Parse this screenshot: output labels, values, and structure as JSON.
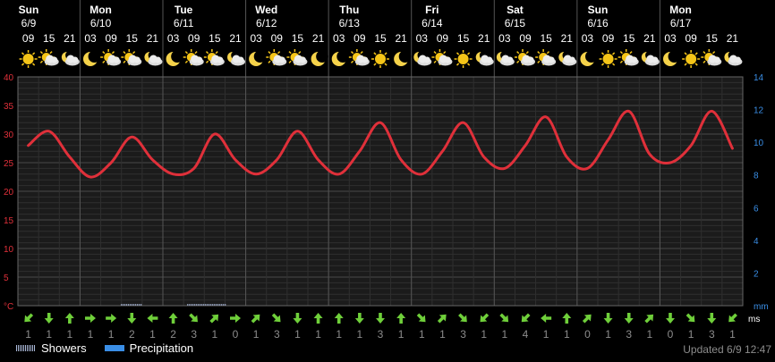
{
  "days": [
    {
      "name": "Sun",
      "date": "6/9"
    },
    {
      "name": "Mon",
      "date": "6/10"
    },
    {
      "name": "Tue",
      "date": "6/11"
    },
    {
      "name": "Wed",
      "date": "6/12"
    },
    {
      "name": "Thu",
      "date": "6/13"
    },
    {
      "name": "Fri",
      "date": "6/14"
    },
    {
      "name": "Sat",
      "date": "6/15"
    },
    {
      "name": "Sun",
      "date": "6/16"
    },
    {
      "name": "Mon",
      "date": "6/17"
    }
  ],
  "legend": {
    "showers": "Showers",
    "precipitation": "Precipitation"
  },
  "updated": "Updated 6/9 12:47",
  "colors": {
    "temperature": "#e0303a",
    "left_axis": "#e0303a",
    "right_axis": "#3a8ee6",
    "wind_arrow": "#6fcf3a",
    "precipitation": "#3a8ee6"
  },
  "chart_data": {
    "type": "line",
    "x": [
      "09",
      "15",
      "21",
      "03",
      "09",
      "15",
      "21",
      "03",
      "09",
      "15",
      "21",
      "03",
      "09",
      "15",
      "21",
      "03",
      "09",
      "15",
      "21",
      "03",
      "09",
      "15",
      "21",
      "03",
      "09",
      "15",
      "21",
      "03",
      "09",
      "15",
      "21",
      "03",
      "09",
      "15",
      "21"
    ],
    "series": [
      {
        "values": [
          28,
          30.5,
          26,
          22.5,
          25,
          29.5,
          25.5,
          23,
          24,
          30,
          25.5,
          23,
          25.5,
          30.5,
          25.5,
          23,
          27,
          32,
          25.5,
          23,
          27,
          32,
          26,
          24,
          28,
          33,
          26,
          24,
          29,
          34,
          26.5,
          25,
          28,
          34,
          27.5
        ]
      }
    ],
    "wind_icons": [
      "arrow-sw",
      "arrow-s",
      "arrow-n",
      "arrow-e",
      "arrow-e",
      "arrow-s",
      "arrow-w",
      "arrow-n",
      "arrow-se",
      "arrow-ne",
      "arrow-e",
      "arrow-ne",
      "arrow-se",
      "arrow-s",
      "arrow-n",
      "arrow-n",
      "arrow-s",
      "arrow-s",
      "arrow-n",
      "arrow-se",
      "arrow-ne",
      "arrow-se",
      "arrow-sw",
      "arrow-se",
      "arrow-sw",
      "arrow-w",
      "arrow-n",
      "arrow-ne",
      "arrow-s",
      "arrow-s",
      "arrow-ne",
      "arrow-s",
      "arrow-se",
      "arrow-s",
      "arrow-sw"
    ],
    "wind_speeds": [
      "1",
      "1",
      "1",
      "1",
      "1",
      "2",
      "1",
      "2",
      "3",
      "1",
      "0",
      "1",
      "3",
      "1",
      "1",
      "1",
      "1",
      "3",
      "1",
      "1",
      "1",
      "3",
      "1",
      "1",
      "4",
      "1",
      "1",
      "0",
      "1",
      "3",
      "1",
      "0",
      "1",
      "3",
      "1"
    ],
    "weather_icons": [
      "sun-icon",
      "sun-cloud-icon",
      "moon-cloud-icon",
      "moon-icon",
      "sun-cloud-icon",
      "sun-cloud-icon",
      "moon-cloud-icon",
      "moon-icon",
      "sun-cloud-icon",
      "sun-cloud-icon",
      "moon-cloud-icon",
      "moon-icon",
      "sun-cloud-icon",
      "sun-cloud-icon",
      "moon-icon",
      "moon-icon",
      "sun-cloud-icon",
      "sun-icon",
      "moon-icon",
      "moon-cloud-icon",
      "sun-cloud-icon",
      "sun-icon",
      "moon-cloud-icon",
      "moon-cloud-icon",
      "sun-cloud-icon",
      "sun-cloud-icon",
      "moon-cloud-icon",
      "moon-icon",
      "sun-icon",
      "sun-cloud-icon",
      "moon-cloud-icon",
      "moon-icon",
      "sun-icon",
      "sun-cloud-icon",
      "moon-cloud-icon"
    ],
    "showers": [
      {
        "from": 4.5,
        "to": 5.5
      },
      {
        "from": 7.7,
        "to": 9.6
      }
    ],
    "yticks_left": [
      "40",
      "35",
      "30",
      "25",
      "20",
      "15",
      "10",
      "5",
      "°C"
    ],
    "yticks_right": [
      "14",
      "12",
      "10",
      "8",
      "6",
      "4",
      "2",
      "mm"
    ],
    "ylim_left": [
      0,
      40
    ],
    "ylim_right": [
      0,
      14
    ],
    "x_unit": "ms",
    "grid": true
  }
}
